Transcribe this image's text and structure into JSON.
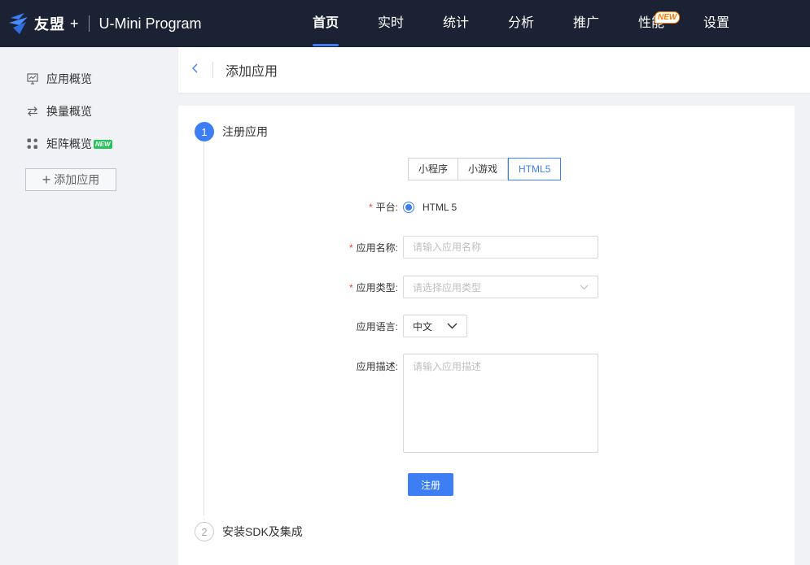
{
  "header": {
    "brand": "友盟",
    "brand_plus": "+",
    "product": "U-Mini Program",
    "nav": [
      {
        "label": "首页",
        "active": true
      },
      {
        "label": "实时"
      },
      {
        "label": "统计"
      },
      {
        "label": "分析"
      },
      {
        "label": "推广"
      },
      {
        "label": "性能",
        "badge": "NEW"
      },
      {
        "label": "设置"
      }
    ]
  },
  "sidebar": {
    "items": [
      {
        "label": "应用概览",
        "icon": "monitor-chart-icon"
      },
      {
        "label": "换量概览",
        "icon": "swap-arrows-icon"
      },
      {
        "label": "矩阵概览",
        "icon": "grid-icon",
        "badge": "NEW"
      }
    ],
    "add_button": "添加应用"
  },
  "page": {
    "back_icon": "chevron-left-icon",
    "title": "添加应用"
  },
  "steps": [
    {
      "number": "1",
      "label": "注册应用",
      "state": "active"
    },
    {
      "number": "2",
      "label": "安装SDK及集成",
      "state": "pending"
    }
  ],
  "form": {
    "type_tabs": [
      {
        "label": "小程序"
      },
      {
        "label": "小游戏"
      },
      {
        "label": "HTML5",
        "active": true
      }
    ],
    "platform": {
      "label": "平台:",
      "required": true,
      "option": "HTML 5"
    },
    "app_name": {
      "label": "应用名称:",
      "required": true,
      "placeholder": "请输入应用名称",
      "value": ""
    },
    "app_type": {
      "label": "应用类型:",
      "required": true,
      "placeholder": "请选择应用类型"
    },
    "app_language": {
      "label": "应用语言:",
      "value": "中文"
    },
    "app_description": {
      "label": "应用描述:",
      "placeholder": "请输入应用描述",
      "value": ""
    },
    "submit_label": "注册"
  },
  "colors": {
    "topbar": "#1a2233",
    "accent": "#3d7ef5",
    "required": "#f04134",
    "new_badge_orange": "#ff7a00",
    "new_badge_green": "#25c25a"
  }
}
